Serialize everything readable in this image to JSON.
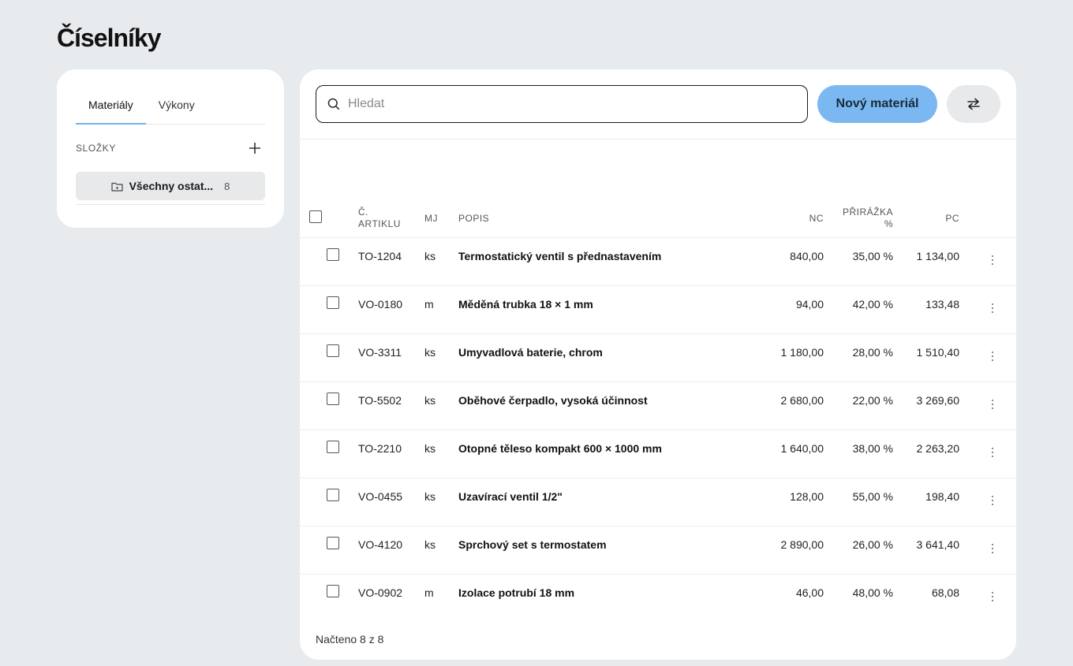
{
  "page": {
    "title": "Číselníky"
  },
  "sidebar": {
    "tabs": [
      {
        "label": "Materiály",
        "active": true
      },
      {
        "label": "Výkony",
        "active": false
      }
    ],
    "folders_label": "SLOŽKY",
    "folder": {
      "name": "Všechny ostat...",
      "count": "8"
    }
  },
  "toolbar": {
    "search_placeholder": "Hledat",
    "new_button": "Nový materiál"
  },
  "table": {
    "headers": {
      "code_line1": "Č.",
      "code_line2": "ARTIKLU",
      "mj": "MJ",
      "popis": "POPIS",
      "nc": "NC",
      "prirazka_line1": "PŘIRÁŽKA",
      "prirazka_line2": "%",
      "pc": "PC"
    },
    "rows": [
      {
        "code": "TO-1204",
        "mj": "ks",
        "popis": "Termostatický ventil s přednastavením",
        "nc": "840,00",
        "prirazka": "35,00 %",
        "pc": "1 134,00"
      },
      {
        "code": "VO-0180",
        "mj": "m",
        "popis": "Měděná trubka 18 × 1 mm",
        "nc": "94,00",
        "prirazka": "42,00 %",
        "pc": "133,48"
      },
      {
        "code": "VO-3311",
        "mj": "ks",
        "popis": "Umyvadlová baterie, chrom",
        "nc": "1 180,00",
        "prirazka": "28,00 %",
        "pc": "1 510,40"
      },
      {
        "code": "TO-5502",
        "mj": "ks",
        "popis": "Oběhové čerpadlo, vysoká účinnost",
        "nc": "2 680,00",
        "prirazka": "22,00 %",
        "pc": "3 269,60"
      },
      {
        "code": "TO-2210",
        "mj": "ks",
        "popis": "Otopné těleso kompakt 600 × 1000 mm",
        "nc": "1 640,00",
        "prirazka": "38,00 %",
        "pc": "2 263,20"
      },
      {
        "code": "VO-0455",
        "mj": "ks",
        "popis": "Uzavírací ventil 1/2\"",
        "nc": "128,00",
        "prirazka": "55,00 %",
        "pc": "198,40"
      },
      {
        "code": "VO-4120",
        "mj": "ks",
        "popis": "Sprchový set s termostatem",
        "nc": "2 890,00",
        "prirazka": "26,00 %",
        "pc": "3 641,40"
      },
      {
        "code": "VO-0902",
        "mj": "m",
        "popis": "Izolace potrubí 18 mm",
        "nc": "46,00",
        "prirazka": "48,00 %",
        "pc": "68,08"
      }
    ]
  },
  "footer": {
    "loaded": "Načteno 8 z 8"
  },
  "icons": {
    "search": "search-icon",
    "plus": "plus-icon",
    "folder": "folder-icon",
    "swap": "swap-arrows-icon",
    "kebab": "more-vertical-icon"
  },
  "colors": {
    "accent": "#7bb8f2",
    "tab_underline": "#6fb2f0",
    "background": "#e8ebee"
  }
}
